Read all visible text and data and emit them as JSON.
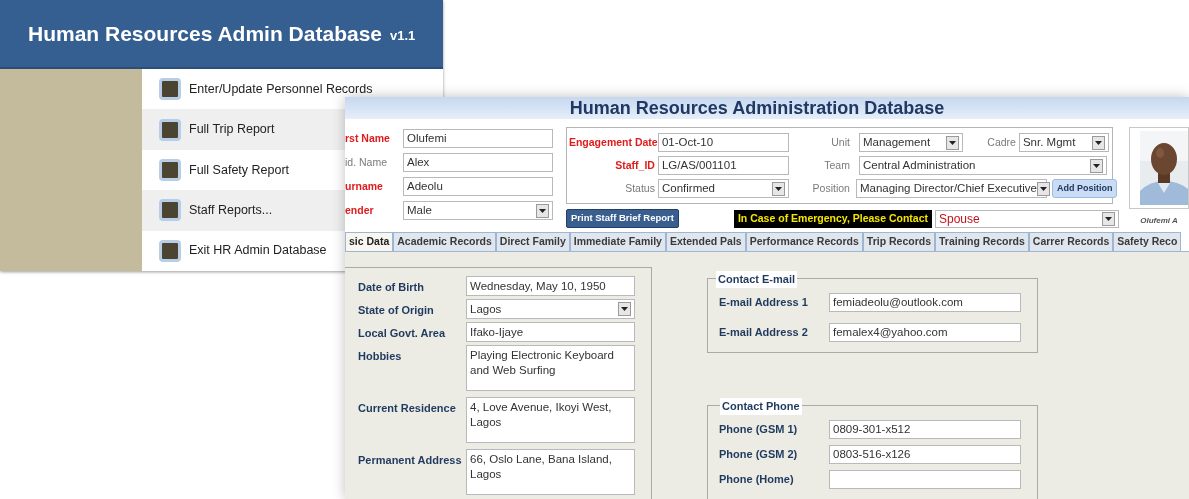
{
  "menu_window": {
    "title": "Human Resources Admin Database",
    "version": "v1.1",
    "items": [
      {
        "label": "Enter/Update Personnel Records"
      },
      {
        "label": "Full Trip Report"
      },
      {
        "label": "Full Safety Report"
      },
      {
        "label": "Staff Reports..."
      },
      {
        "label": "Exit HR Admin Database"
      }
    ]
  },
  "form_window": {
    "title": "Human Resources Administration Database",
    "name_fields": [
      {
        "label": "rst Name",
        "value": "Olufemi",
        "required": true,
        "kind": "text"
      },
      {
        "label": "id. Name",
        "value": "Alex",
        "required": false,
        "kind": "text"
      },
      {
        "label": "urname",
        "value": "Adeolu",
        "required": true,
        "kind": "text"
      },
      {
        "label": "ender",
        "value": "Male",
        "required": true,
        "kind": "select"
      }
    ],
    "job_fields": [
      {
        "label": "Engagement Date",
        "value": "01-Oct-10",
        "required": true,
        "kind": "text"
      },
      {
        "label": "Staff_ID",
        "value": "LG/AS/001101",
        "required": true,
        "kind": "text"
      },
      {
        "label": "Status",
        "value": "Confirmed",
        "required": false,
        "kind": "select"
      },
      {
        "label": "Unit",
        "value": "Management",
        "required": false,
        "kind": "select"
      },
      {
        "label": "Cadre",
        "value": "Snr. Mgmt",
        "required": false,
        "kind": "select"
      },
      {
        "label": "Team",
        "value": "Central Administration",
        "required": false,
        "kind": "select"
      },
      {
        "label": "Position",
        "value": "Managing Director/Chief Executive",
        "required": false,
        "kind": "select"
      }
    ],
    "add_position_button": "Add Position",
    "print_button": "Print Staff Brief Report",
    "emergency_label": "In Case of Emergency, Please Contact",
    "emergency_value": "Spouse",
    "photo_caption": "Olufemi A",
    "tabs": [
      {
        "label": "sic Data",
        "selected": true
      },
      {
        "label": "Academic Records",
        "selected": false
      },
      {
        "label": "Direct Family",
        "selected": false
      },
      {
        "label": "Immediate Family",
        "selected": false
      },
      {
        "label": "Extended Pals",
        "selected": false
      },
      {
        "label": "Performance Records",
        "selected": false
      },
      {
        "label": "Trip Records",
        "selected": false
      },
      {
        "label": "Training Records",
        "selected": false
      },
      {
        "label": "Carrer Records",
        "selected": false
      },
      {
        "label": "Safety Reco",
        "selected": false
      }
    ],
    "personal_fields": [
      {
        "label": "Date of Birth",
        "value": "Wednesday, May 10, 1950",
        "kind": "text"
      },
      {
        "label": "State of Origin",
        "value": "Lagos",
        "kind": "select"
      },
      {
        "label": "Local Govt. Area",
        "value": "Ifako-Ijaye",
        "kind": "text"
      },
      {
        "label": "Hobbies",
        "value": "Playing Electronic Keyboard and Web Surfing",
        "kind": "memo"
      },
      {
        "label": "Current Residence",
        "value": "4, Love Avenue, Ikoyi West, Lagos",
        "kind": "memo"
      },
      {
        "label": "Permanent Address",
        "value": "66, Oslo Lane, Bana Island, Lagos",
        "kind": "memo"
      }
    ],
    "email_group": {
      "title": "Contact E-mail",
      "fields": [
        {
          "label": "E-mail Address 1",
          "value": "femiadeolu@outlook.com"
        },
        {
          "label": "E-mail Address 2",
          "value": "femalex4@yahoo.com"
        }
      ]
    },
    "phone_group": {
      "title": "Contact Phone",
      "fields": [
        {
          "label": "Phone (GSM 1)",
          "value": "0809-301-x512"
        },
        {
          "label": "Phone (GSM 2)",
          "value": "0803-516-x126"
        },
        {
          "label": "Phone (Home)"
        }
      ]
    }
  }
}
